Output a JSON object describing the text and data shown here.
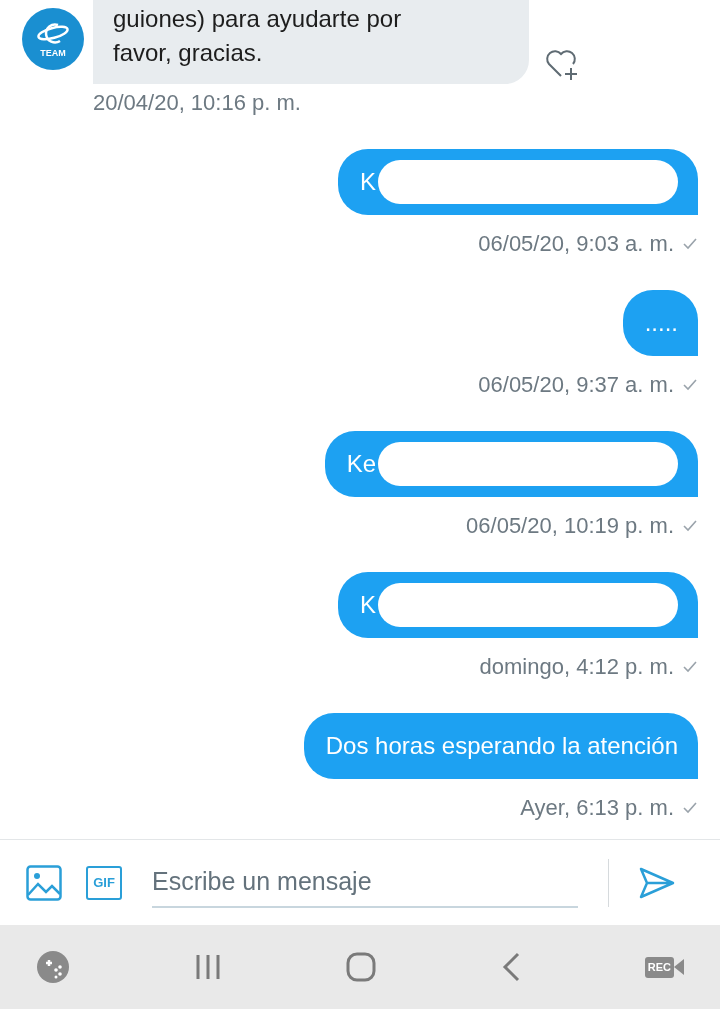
{
  "messages": [
    {
      "kind": "received",
      "lines": [
        "guiones) para ayudarte por",
        "favor, gracias."
      ],
      "time": "20/04/20, 10:16 p. m.",
      "avatar_label": "TEAM"
    },
    {
      "kind": "sent",
      "text": "K",
      "redacted": true,
      "time": "06/05/20, 9:03 a. m."
    },
    {
      "kind": "sent",
      "text": ".....",
      "redacted": false,
      "time": "06/05/20, 9:37 a. m."
    },
    {
      "kind": "sent",
      "text": "Ke",
      "redacted": true,
      "time": "06/05/20, 10:19 p. m."
    },
    {
      "kind": "sent",
      "text": "K",
      "redacted": true,
      "time": "domingo, 4:12 p. m."
    },
    {
      "kind": "sent",
      "text": "Dos horas esperando la atención",
      "redacted": false,
      "time": "Ayer, 6:13 p. m."
    }
  ],
  "composer": {
    "placeholder": "Escribe un mensaje",
    "gif_label": "GIF"
  },
  "navbar": {
    "rec_label": "REC"
  }
}
